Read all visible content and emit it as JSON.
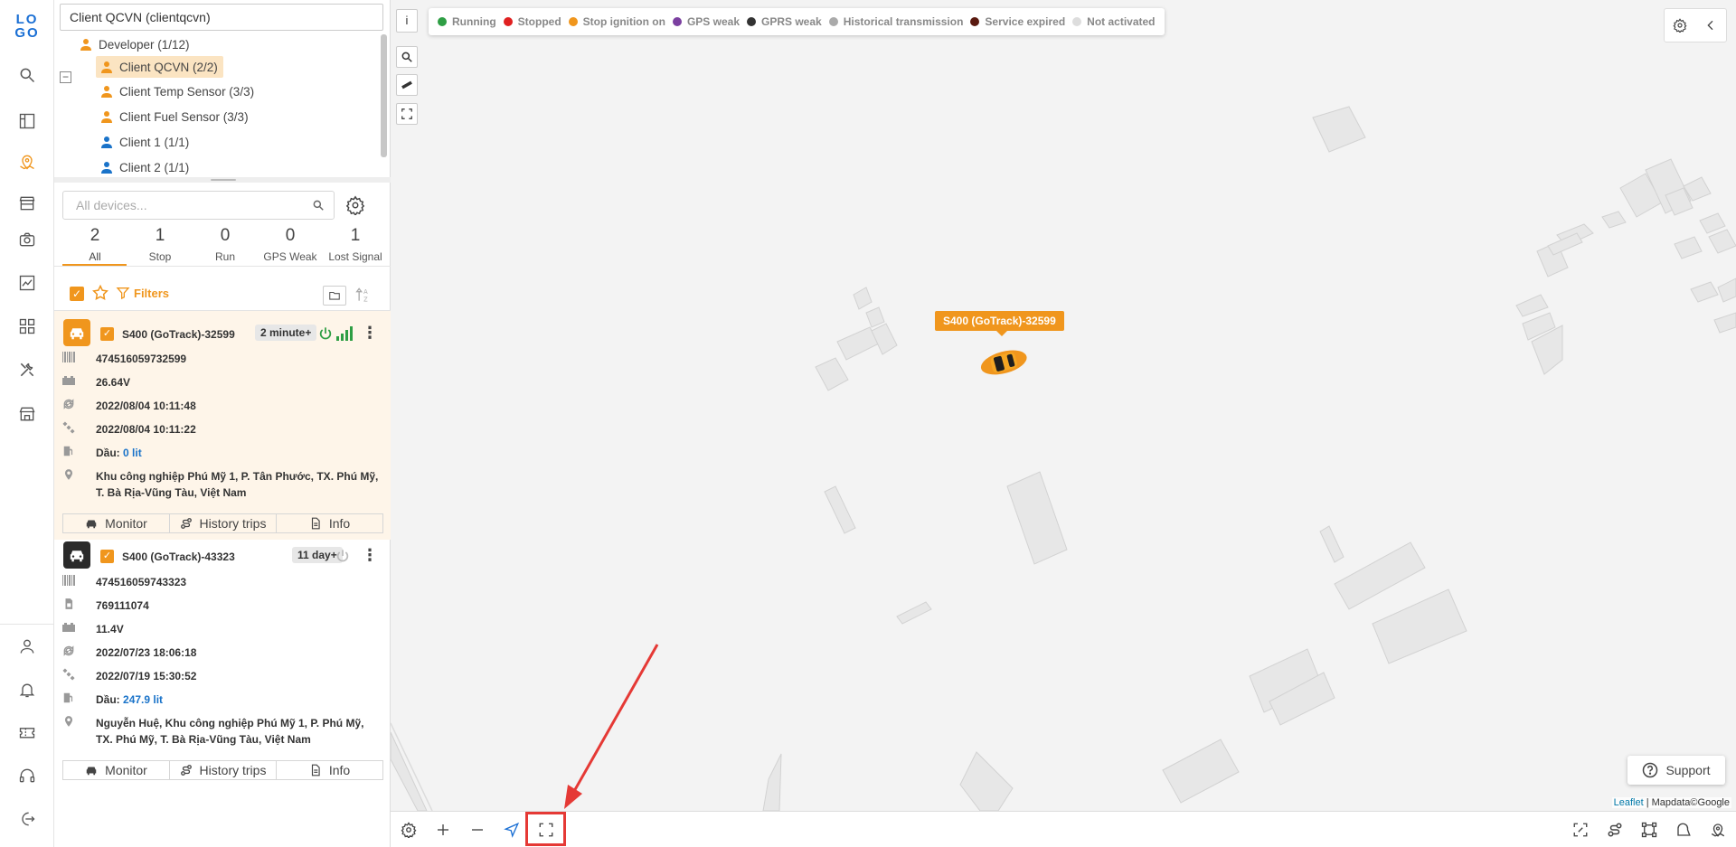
{
  "colors": {
    "accent": "#f0961d",
    "running": "#2e9e44",
    "stopped": "#e02020",
    "stop_ignition": "#f0961d",
    "gps_weak": "#7b3fa0",
    "gprs_weak": "#333333",
    "historical": "#aaaaaa",
    "service_expired": "#5a1a10",
    "not_activated": "#dddddd",
    "highlight": "#e53935"
  },
  "rail": {
    "logo": "LOGO",
    "icons": [
      "search-icon",
      "dashboard-icon",
      "map-icon",
      "store-icon",
      "camera-icon",
      "chart-icon",
      "apps-icon",
      "tools-icon",
      "shop-icon",
      "user-icon",
      "bell-icon",
      "ticket-icon",
      "headset-icon",
      "logout-icon"
    ]
  },
  "sidebar": {
    "account_select": "Client QCVN (clientqcvn)",
    "tree": [
      {
        "label": "Developer (1/12)"
      },
      {
        "label": "Client QCVN (2/2)"
      },
      {
        "label": "Client Temp Sensor (3/3)"
      },
      {
        "label": "Client Fuel Sensor (3/3)"
      },
      {
        "label": "Client 1 (1/1)"
      },
      {
        "label": "Client 2 (1/1)"
      }
    ],
    "search_placeholder": "All devices...",
    "stats": [
      {
        "num": "2",
        "label": "All"
      },
      {
        "num": "1",
        "label": "Stop"
      },
      {
        "num": "0",
        "label": "Run"
      },
      {
        "num": "0",
        "label": "GPS Weak"
      },
      {
        "num": "1",
        "label": "Lost Signal"
      }
    ],
    "filters_label": "Filters",
    "devices": [
      {
        "name": "S400 (GoTrack)-32599",
        "badge": "2 minute+",
        "imei": "474516059732599",
        "voltage": "26.64V",
        "time_update": "2022/08/04 10:11:48",
        "time_gps": "2022/08/04 10:11:22",
        "fuel_label": "Dầu:",
        "fuel_value": "0 lit",
        "address": "Khu công nghiệp Phú Mỹ 1, P. Tân Phước, TX. Phú Mỹ, T. Bà Rịa-Vũng Tàu, Việt Nam"
      },
      {
        "name": "S400 (GoTrack)-43323",
        "badge": "11 day+",
        "imei": "474516059743323",
        "sim": "769111074",
        "voltage": "11.4V",
        "time_update": "2022/07/23 18:06:18",
        "time_gps": "2022/07/19 15:30:52",
        "fuel_label": "Dầu:",
        "fuel_value": "247.9 lit",
        "address": "Nguyễn Huệ, Khu công nghiệp Phú Mỹ 1, P. Phú Mỹ, TX. Phú Mỹ, T. Bà Rịa-Vũng Tàu, Việt Nam"
      }
    ],
    "actions": {
      "monitor": "Monitor",
      "history": "History trips",
      "info": "Info"
    }
  },
  "map": {
    "info_button": "i",
    "legend": [
      {
        "label": "Running",
        "color": "#2e9e44"
      },
      {
        "label": "Stopped",
        "color": "#e02020"
      },
      {
        "label": "Stop ignition on",
        "color": "#f0961d"
      },
      {
        "label": "GPS weak",
        "color": "#7b3fa0"
      },
      {
        "label": "GPRS weak",
        "color": "#333333"
      },
      {
        "label": "Historical transmission",
        "color": "#aaaaaa"
      },
      {
        "label": "Service expired",
        "color": "#5a1a10"
      },
      {
        "label": "Not activated",
        "color": "#dddddd"
      }
    ],
    "vehicle_label": "S400 (GoTrack)-32599",
    "support_label": "Support",
    "attribution_leaflet": "Leaflet",
    "attribution_rest": " | Mapdata©Google"
  }
}
